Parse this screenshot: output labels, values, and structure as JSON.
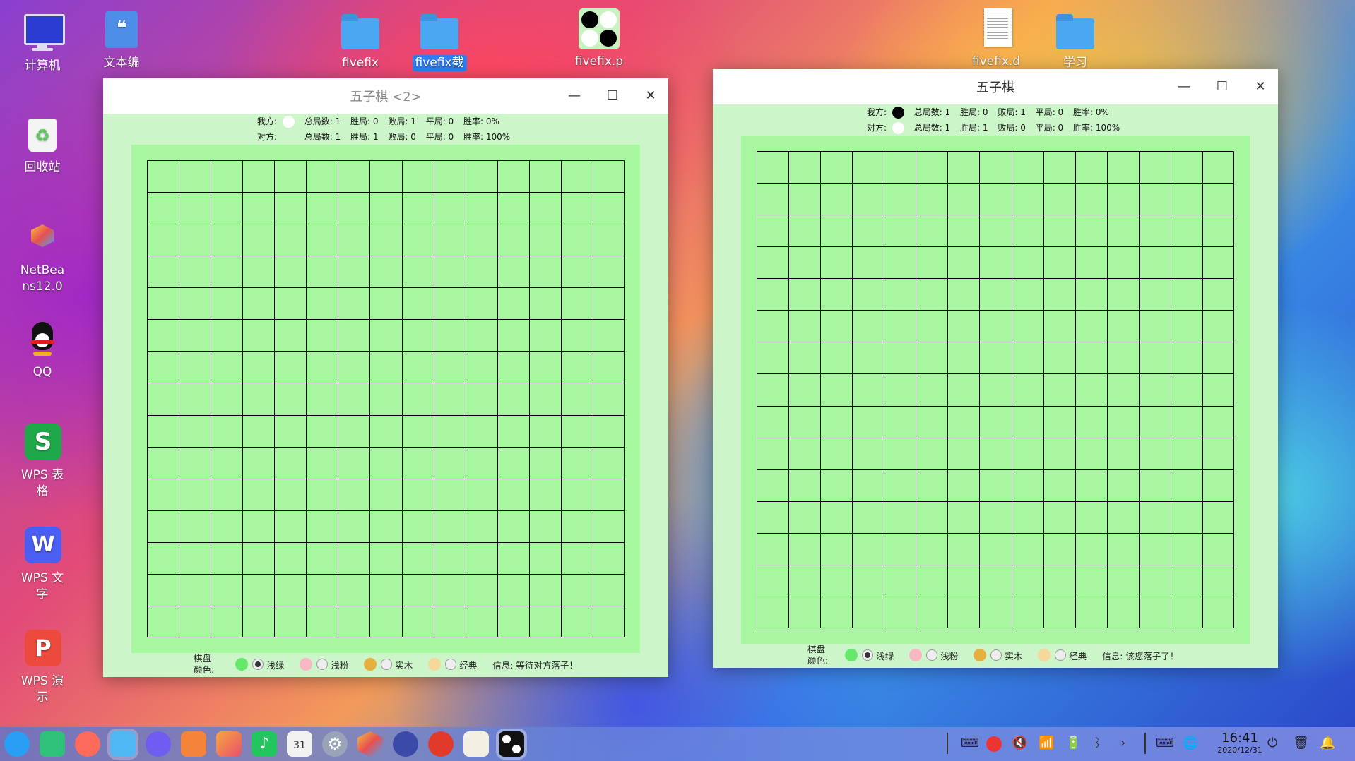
{
  "desktop": {
    "icons": [
      {
        "label": "计算机"
      },
      {
        "label": "文本编"
      },
      {
        "label": "回收站"
      },
      {
        "label": "NetBea\nns12.0"
      },
      {
        "label": "QQ"
      },
      {
        "label": "WPS 表\n格"
      },
      {
        "label": "WPS 文\n字"
      },
      {
        "label": "WPS 演\n示"
      },
      {
        "label": "fivefix"
      },
      {
        "label": "fivefix截"
      },
      {
        "label": "fivefix.p"
      },
      {
        "label": "fivefix.d"
      },
      {
        "label": "学习"
      }
    ]
  },
  "win_left": {
    "title": "五子棋 <2>",
    "me_label": "我方:",
    "opp_label": "对方:",
    "me_stats": {
      "total": "总局数: 1",
      "win": "胜局: 0",
      "lose": "败局: 1",
      "draw": "平局: 0",
      "rate": "胜率: 0%"
    },
    "opp_stats": {
      "total": "总局数: 1",
      "win": "胜局: 1",
      "lose": "败局: 0",
      "draw": "平局: 0",
      "rate": "胜率: 100%"
    },
    "board_label_1": "棋盘",
    "board_label_2": "颜色:",
    "options": [
      "浅绿",
      "浅粉",
      "实木",
      "经典"
    ],
    "info": "信息: 等待对方落子！"
  },
  "win_right": {
    "title": "五子棋",
    "me_label": "我方:",
    "opp_label": "对方:",
    "me_stats": {
      "total": "总局数: 1",
      "win": "胜局: 0",
      "lose": "败局: 1",
      "draw": "平局: 0",
      "rate": "胜率: 0%"
    },
    "opp_stats": {
      "total": "总局数: 1",
      "win": "胜局: 1",
      "lose": "败局: 0",
      "draw": "平局: 0",
      "rate": "胜率: 100%"
    },
    "board_label_1": "棋盘",
    "board_label_2": "颜色:",
    "options": [
      "浅绿",
      "浅粉",
      "实木",
      "经典"
    ],
    "info": "信息: 该您落子了！"
  },
  "board": {
    "cells": 15,
    "line_color": "#000000",
    "fill": "#a6f7a0"
  },
  "swatch_colors": [
    "#66e86a",
    "#f7b8c4",
    "#e6b040",
    "#f5d99a"
  ],
  "clock": {
    "time": "16:41",
    "date": "2020/12/31"
  },
  "calendar_day": "31"
}
